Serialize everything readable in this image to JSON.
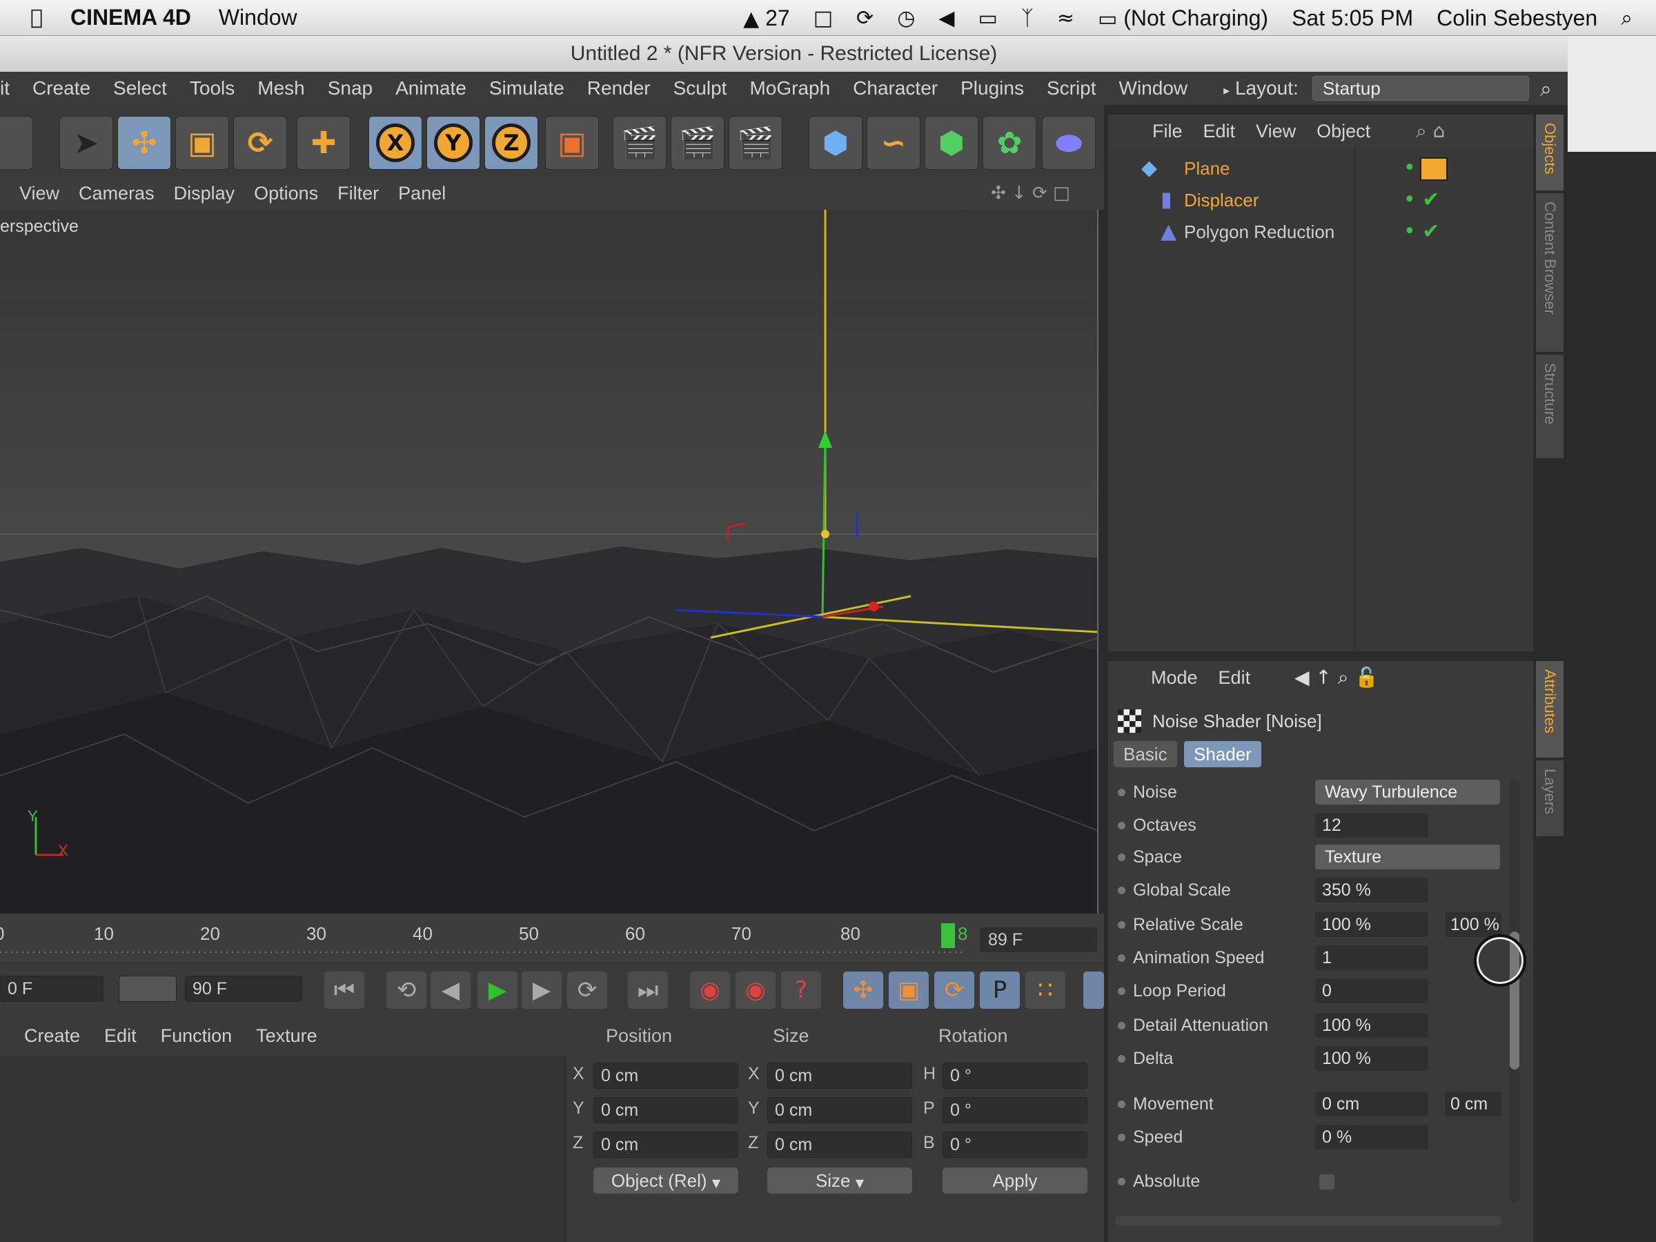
{
  "macbar": {
    "app": "CINEMA 4D",
    "window": "Window",
    "adobe_count": "27",
    "battery": "(Not Charging)",
    "clock": "Sat 5:05 PM",
    "user": "Colin Sebestyen"
  },
  "title": "Untitled 2 * (NFR Version - Restricted License)",
  "menu": {
    "items": [
      "it",
      "Create",
      "Select",
      "Tools",
      "Mesh",
      "Snap",
      "Animate",
      "Simulate",
      "Render",
      "Sculpt",
      "MoGraph",
      "Character",
      "Plugins",
      "Script",
      "Window"
    ],
    "layout_label": "Layout:",
    "layout_value": "Startup"
  },
  "viewport": {
    "menu": [
      "View",
      "Cameras",
      "Display",
      "Options",
      "Filter",
      "Panel"
    ],
    "label": "erspective",
    "axis_y": "Y",
    "axis_x": "X"
  },
  "timeline": {
    "ticks": [
      "0",
      "10",
      "20",
      "30",
      "40",
      "50",
      "60",
      "70",
      "80"
    ],
    "marker": "8",
    "frame": "89 F"
  },
  "transport": {
    "start": "0 F",
    "end": "90 F"
  },
  "material": {
    "menu": [
      "Create",
      "Edit",
      "Function",
      "Texture"
    ]
  },
  "coords": {
    "headers": [
      "Position",
      "Size",
      "Rotation"
    ],
    "rows": [
      {
        "a": "X",
        "pos": "0 cm",
        "b": "X",
        "size": "0 cm",
        "c": "H",
        "rot": "0 °"
      },
      {
        "a": "Y",
        "pos": "0 cm",
        "b": "Y",
        "size": "0 cm",
        "c": "P",
        "rot": "0 °"
      },
      {
        "a": "Z",
        "pos": "0 cm",
        "b": "Z",
        "size": "0 cm",
        "c": "B",
        "rot": "0 °"
      }
    ],
    "mode": "Object (Rel)",
    "size_mode": "Size",
    "apply": "Apply"
  },
  "objects": {
    "menu": [
      "File",
      "Edit",
      "View",
      "Object"
    ],
    "items": [
      {
        "name": "Plane",
        "color": "#e8a040"
      },
      {
        "name": "Displacer",
        "color": "#f0a830"
      },
      {
        "name": "Polygon Reduction",
        "color": "#cfcfcf"
      }
    ],
    "side_tabs": [
      "Objects",
      "Content Browser",
      "Structure"
    ]
  },
  "attributes": {
    "menu": [
      "Mode",
      "Edit"
    ],
    "header": "Noise Shader [Noise]",
    "tabs": [
      "Basic",
      "Shader"
    ],
    "side_tabs": [
      "Attributes",
      "Layers"
    ],
    "rows": [
      {
        "label": "Noise",
        "type": "drop",
        "value": "Wavy Turbulence"
      },
      {
        "label": "Octaves",
        "type": "val",
        "value": "12"
      },
      {
        "label": "Space",
        "type": "drop",
        "value": "Texture"
      },
      {
        "label": "Global Scale",
        "type": "val",
        "value": "350 %"
      },
      {
        "label": "Relative Scale",
        "type": "val",
        "value": "100 %",
        "value2": "100 %"
      },
      {
        "label": "Animation Speed",
        "type": "val",
        "value": "1"
      },
      {
        "label": "Loop Period",
        "type": "val",
        "value": "0"
      },
      {
        "label": "Detail Attenuation",
        "type": "val",
        "value": "100 %"
      },
      {
        "label": "Delta",
        "type": "val",
        "value": "100 %"
      },
      {
        "label": "Movement",
        "type": "val",
        "value": "0 cm",
        "value2": "0 cm"
      },
      {
        "label": "Speed",
        "type": "val",
        "value": "0 %"
      },
      {
        "label": "Absolute",
        "type": "check",
        "value": ""
      }
    ]
  }
}
